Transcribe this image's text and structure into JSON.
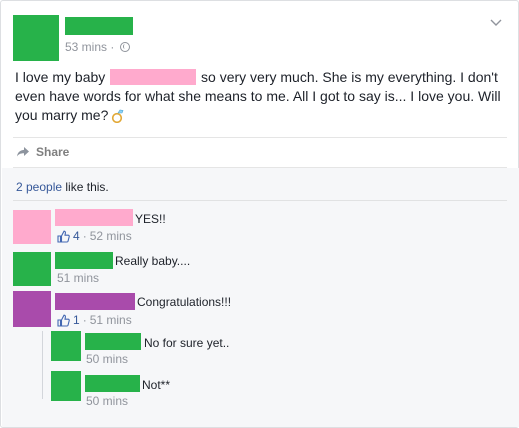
{
  "post": {
    "time": "53 mins",
    "separator": "·",
    "text_line1_a": "I love my baby",
    "text_line1_b": "so very very much. She is my everything. I don't",
    "text_line2": "even have words for what she means to me. All I got to say is... I love you.",
    "text_line3": "Will you marry me?",
    "share_label": "Share"
  },
  "likes": {
    "count_label": "2 people",
    "suffix": "like this."
  },
  "comments": [
    {
      "text": "YES!!",
      "likes": "4",
      "time": "52 mins",
      "color": "#ffaacd"
    },
    {
      "text": "Really baby....",
      "time": "51 mins",
      "color": "#27b24a"
    },
    {
      "text": "Congratulations!!!",
      "likes": "1",
      "time": "51 mins",
      "color": "#a94bab"
    },
    {
      "text": "No for sure yet..",
      "time": "50 mins",
      "color": "#27b24a"
    },
    {
      "text": "Not**",
      "time": "50 mins",
      "color": "#27b24a"
    }
  ],
  "colors": {
    "redaction_green": "#27b24a",
    "redaction_pink": "#ffaacd",
    "redaction_purple": "#a94bab",
    "link_blue": "#365899",
    "meta_grey": "#90949c"
  },
  "icons": [
    "globe-icon",
    "chevron-down-icon",
    "ring-emoji-icon",
    "share-arrow-icon",
    "like-thumb-icon"
  ]
}
